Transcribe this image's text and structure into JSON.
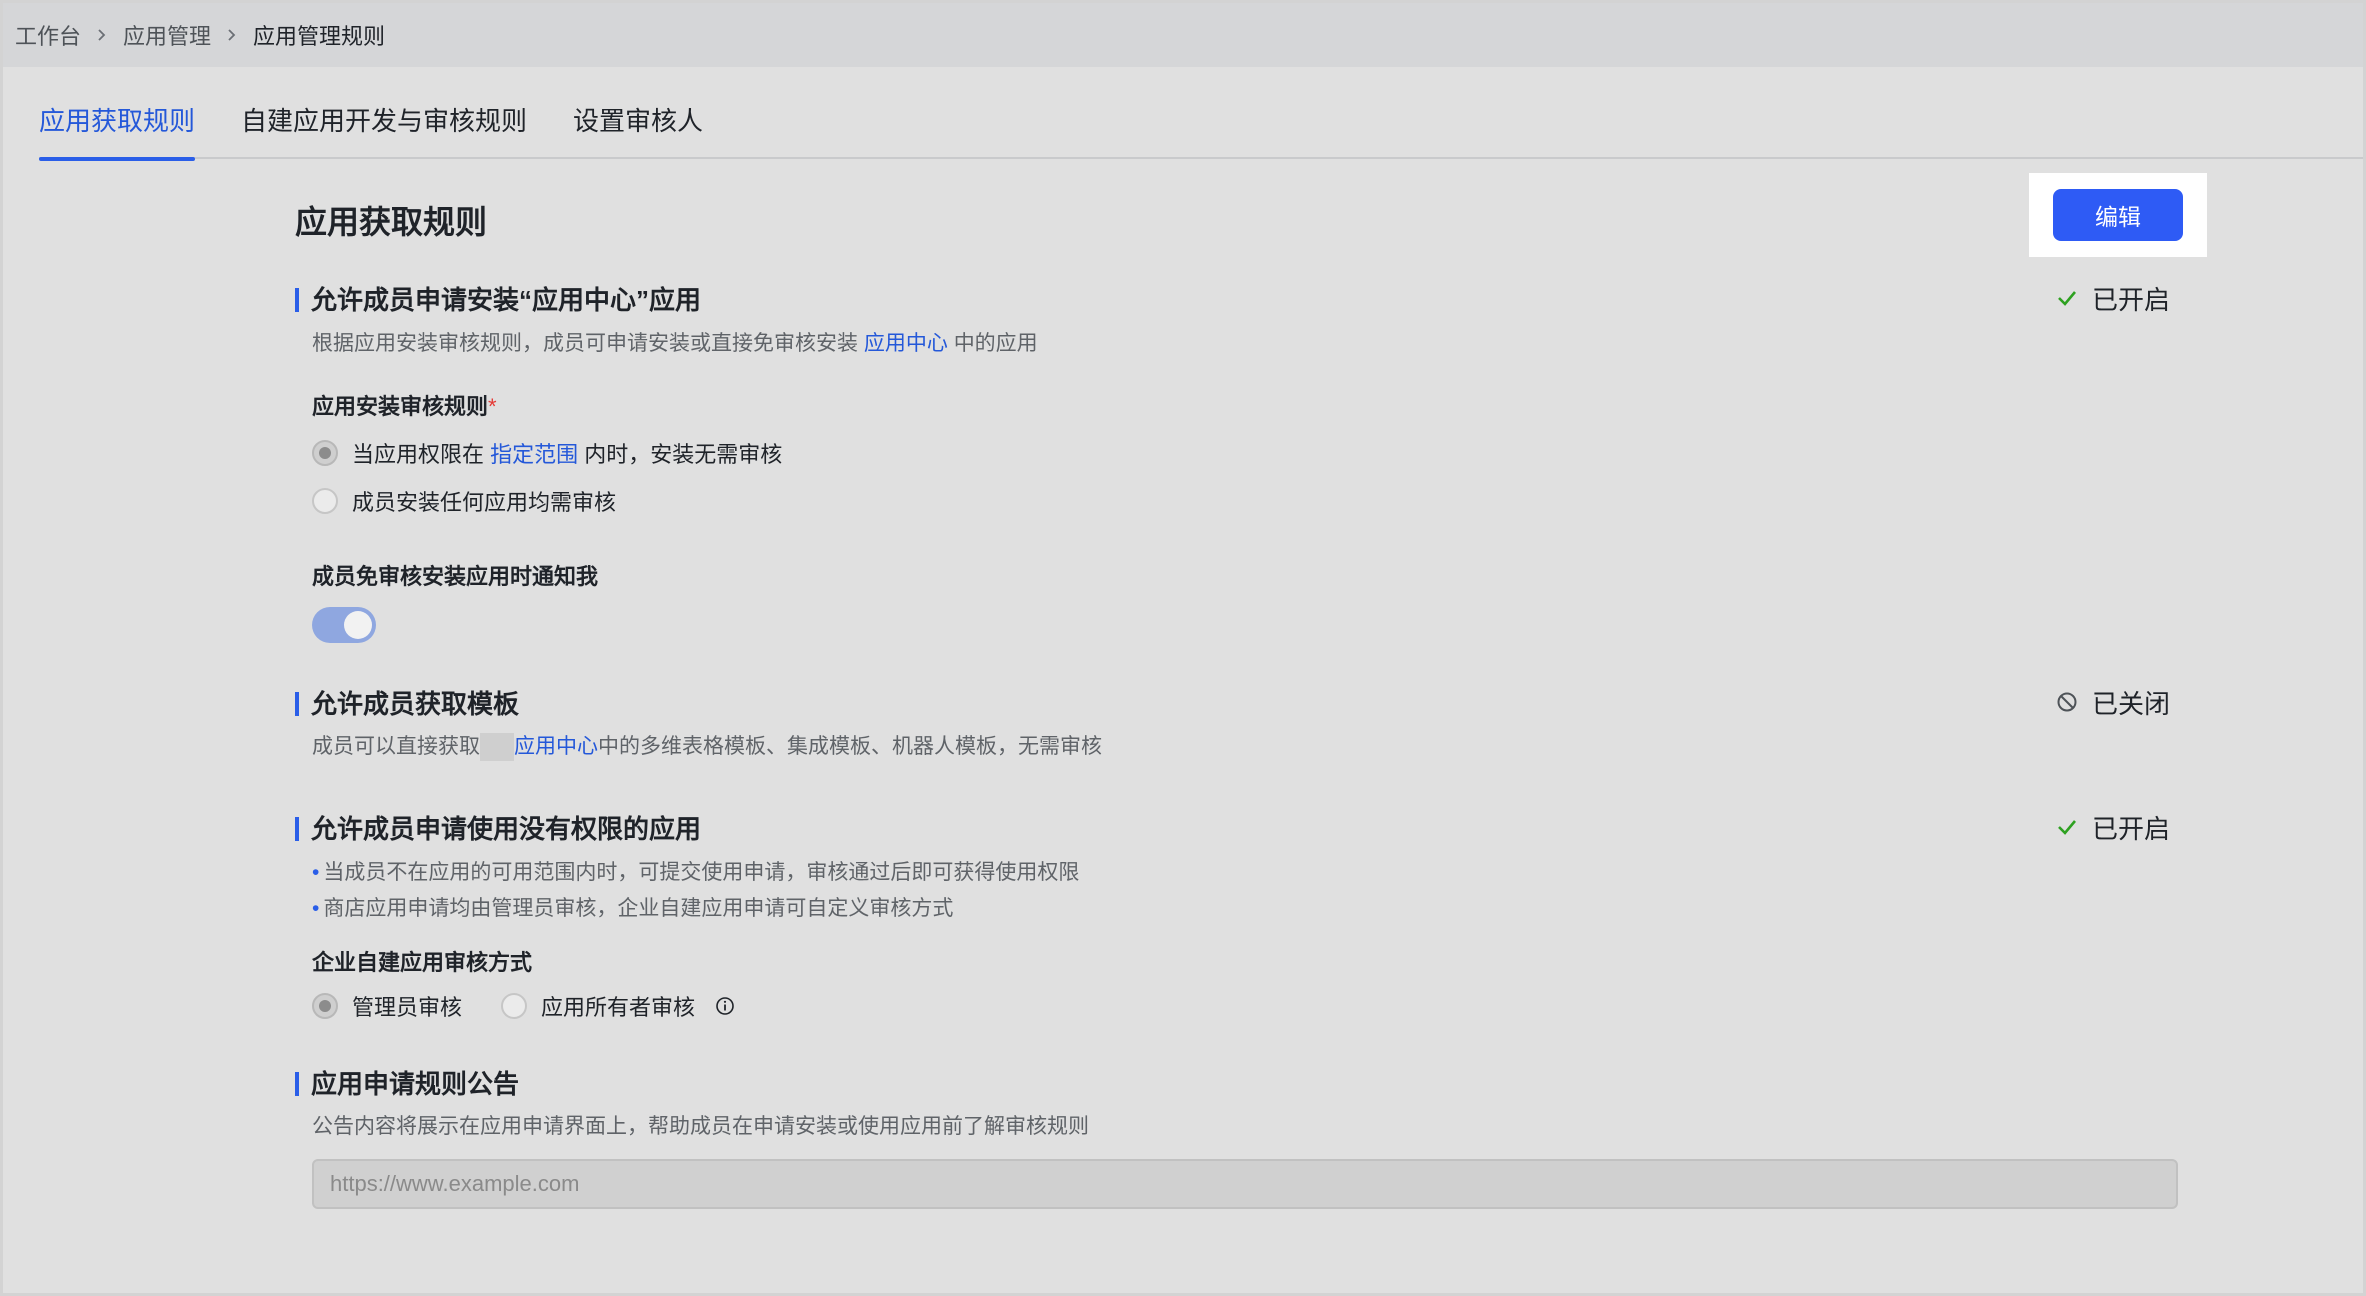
{
  "breadcrumb": {
    "items": [
      "工作台",
      "应用管理",
      "应用管理规则"
    ]
  },
  "tabs": [
    {
      "label": "应用获取规则",
      "active": true
    },
    {
      "label": "自建应用开发与审核规则",
      "active": false
    },
    {
      "label": "设置审核人",
      "active": false
    }
  ],
  "page": {
    "title": "应用获取规则",
    "edit_label": "编辑"
  },
  "section1": {
    "title": "允许成员申请安装“应用中心”应用",
    "status": "已开启",
    "desc_before": "根据应用安装审核规则，成员可申请安装或直接免审核安装",
    "desc_link": "应用中心",
    "desc_after": "中的应用",
    "rule_label": "应用安装审核规则",
    "required_mark": "*",
    "radio1_before": "当应用权限在",
    "radio1_link": "指定范围",
    "radio1_after": "内时，安装无需审核",
    "radio2": "成员安装任何应用均需审核",
    "notify_label": "成员免审核安装应用时通知我",
    "notify_on": true
  },
  "section2": {
    "title": "允许成员获取模板",
    "status": "已关闭",
    "desc_before": "成员可以直接获取",
    "desc_link": "应用中心",
    "desc_after": "中的多维表格模板、集成模板、机器人模板，无需审核"
  },
  "section3": {
    "title": "允许成员申请使用没有权限的应用",
    "status": "已开启",
    "bullet1": "当成员不在应用的可用范围内时，可提交使用申请，审核通过后即可获得使用权限",
    "bullet2": "商店应用申请均由管理员审核，企业自建应用申请可自定义审核方式",
    "method_label": "企业自建应用审核方式",
    "radio_admin": "管理员审核",
    "radio_owner": "应用所有者审核"
  },
  "section4": {
    "title": "应用申请规则公告",
    "desc": "公告内容将展示在应用申请界面上，帮助成员在申请安装或使用应用前了解审核规则",
    "placeholder": "https://www.example.com"
  },
  "colors": {
    "accent": "#2e5bf5",
    "link": "#2458d9",
    "success": "#2ea121"
  },
  "icons": {
    "on_status": "check-icon",
    "off_status": "ban-icon",
    "info": "info-circle-icon",
    "breadcrumb_sep": "chevron-right-icon"
  }
}
